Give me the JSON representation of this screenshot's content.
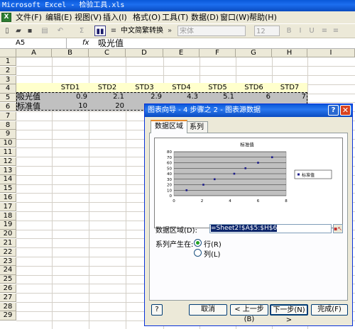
{
  "window": {
    "title": "Microsoft Excel - 检验工具.xls"
  },
  "menu": [
    "文件(F)",
    "编辑(E)",
    "视图(V)",
    "插入(I)",
    "格式(O)",
    "工具(T)",
    "数据(D)",
    "窗口(W)",
    "帮助(H)"
  ],
  "toolbar": {
    "sigma": "Σ",
    "convert_label": "中文简繁转换",
    "font_value": "宋体",
    "size_value": "12"
  },
  "formula_bar": {
    "name_box": "A5",
    "fx": "fx",
    "formula": "吸光值"
  },
  "sheet": {
    "columns": [
      "A",
      "B",
      "C",
      "D",
      "E",
      "F",
      "G",
      "H",
      "I"
    ],
    "rows": [
      "1",
      "2",
      "3",
      "4",
      "5",
      "6",
      "7",
      "8",
      "9",
      "10",
      "11",
      "12",
      "13",
      "14",
      "15",
      "16",
      "17",
      "18",
      "19",
      "20",
      "21",
      "22",
      "23",
      "24",
      "25",
      "26",
      "27",
      "28",
      "29"
    ],
    "headers": [
      "STD1",
      "STD2",
      "STD3",
      "STD4",
      "STD5",
      "STD6",
      "STD7"
    ],
    "row5_label": "吸光值",
    "row5_values": [
      "0.9",
      "2.1",
      "2.9",
      "4.3",
      "5.1",
      "6",
      "7"
    ],
    "row6_label": "标准值",
    "row6_values": [
      "10",
      "20"
    ]
  },
  "dialog": {
    "title": "图表向导 - 4 步骤之 2 - 图表源数据",
    "help_glyph": "?",
    "close_glyph": "✕",
    "tabs": [
      "数据区域",
      "系列"
    ],
    "range_label": "数据区域(D):",
    "range_value": "=Sheet2!$A$5:$H$6",
    "series_label": "系列产生在:",
    "options": [
      "行(R)",
      "列(L)"
    ],
    "selected_option": "行(R)",
    "help_button": "?",
    "buttons": {
      "cancel": "取消",
      "back": "< 上一步(B)",
      "next": "下一步(N) >",
      "finish": "完成(F)"
    }
  },
  "chart_data": {
    "type": "scatter",
    "title": "标准值",
    "series": [
      {
        "name": "标准值",
        "x": [
          0.9,
          2.1,
          2.9,
          4.3,
          5.1,
          6,
          7
        ],
        "values": [
          10,
          20,
          30,
          40,
          50,
          60,
          70
        ]
      }
    ],
    "xlim": [
      0,
      8
    ],
    "ylim": [
      0,
      80
    ],
    "xticks": [
      "0",
      "2",
      "4",
      "6",
      "8"
    ],
    "yticks": [
      "0",
      "10",
      "20",
      "30",
      "40",
      "50",
      "60",
      "70",
      "80"
    ],
    "legend_position": "right",
    "grid": true,
    "colors": {
      "marker": "#1a1a8a",
      "plot_area": "#c0c0c0"
    }
  }
}
